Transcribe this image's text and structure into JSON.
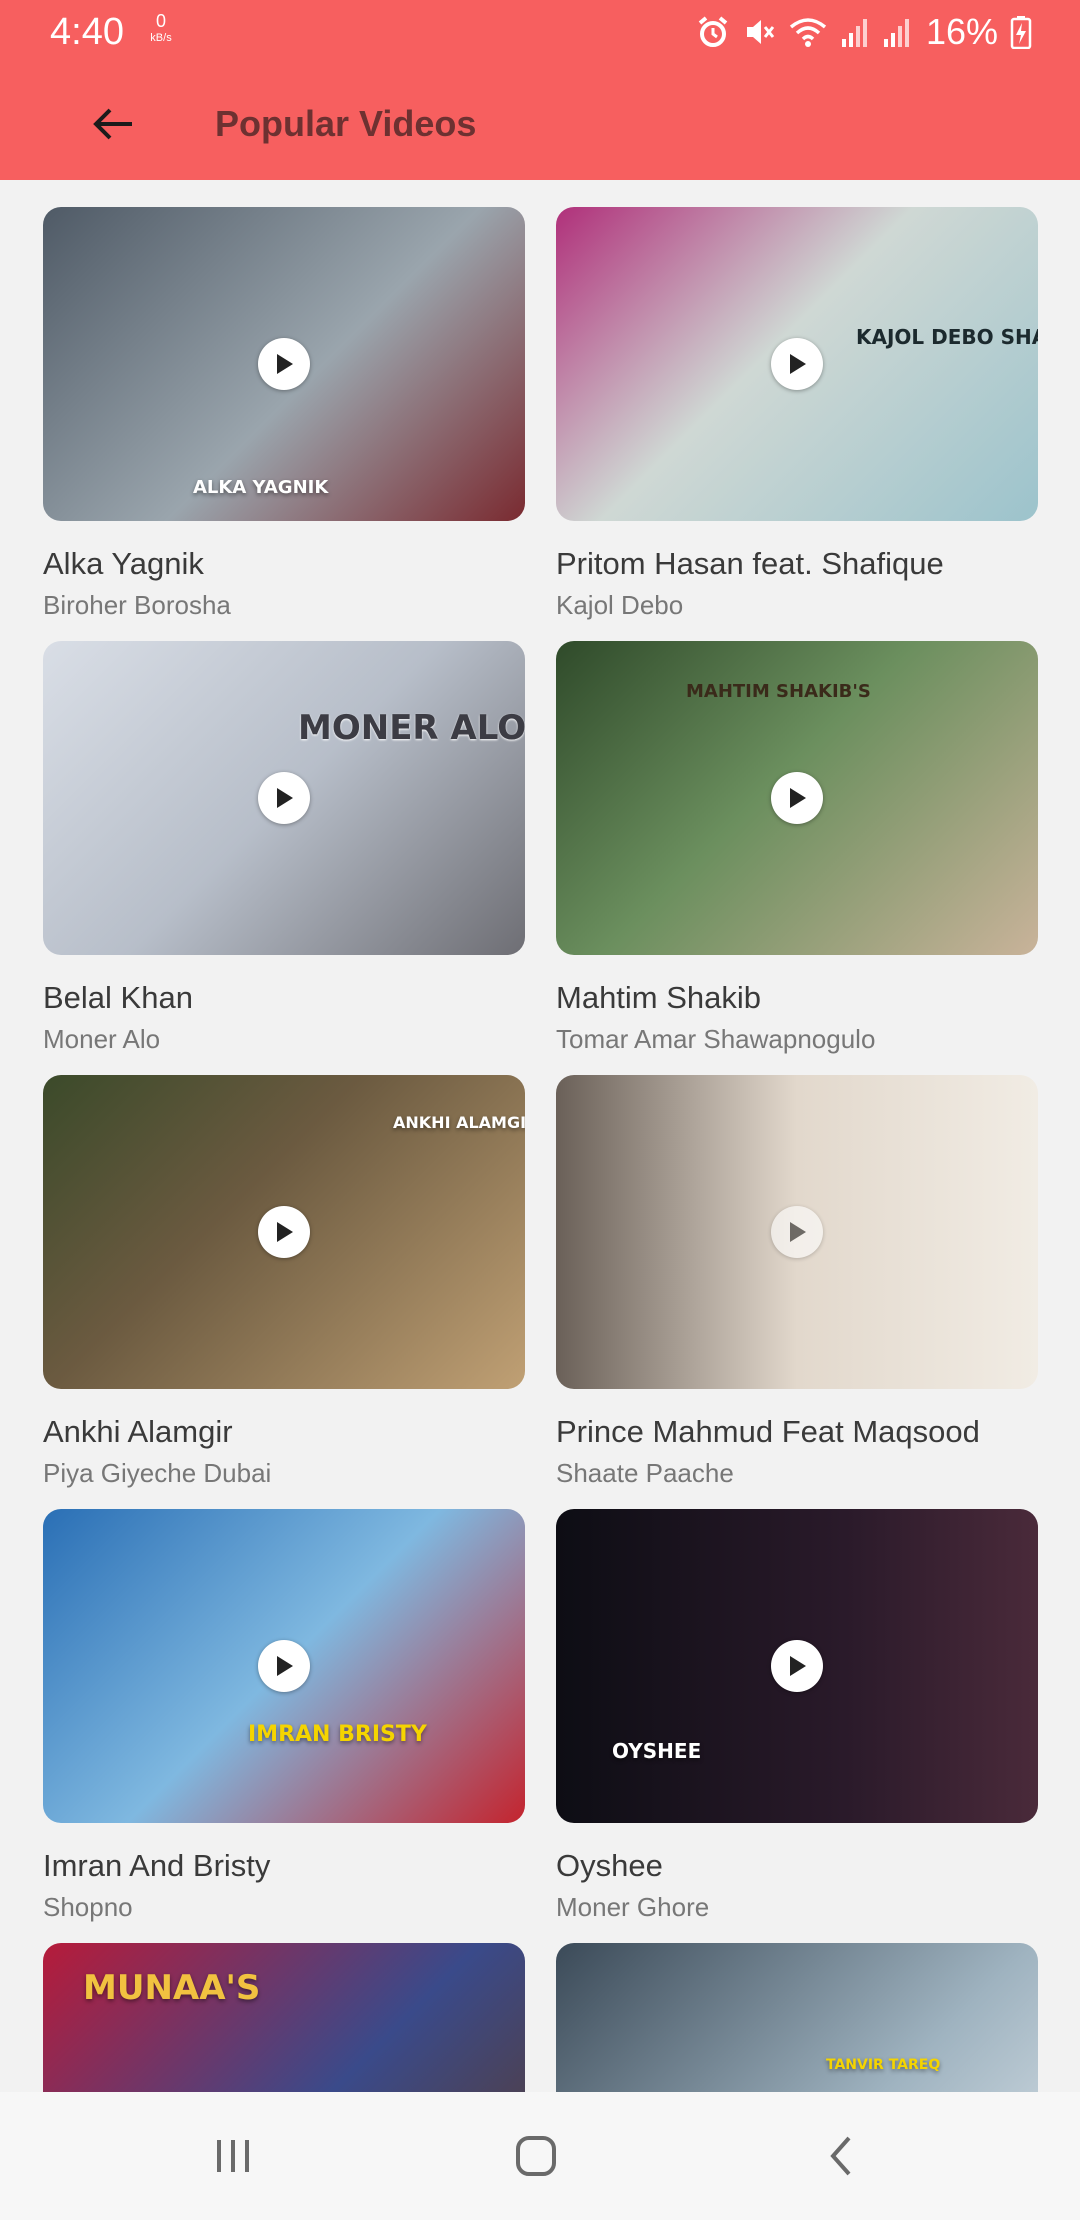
{
  "status_bar": {
    "time": "4:40",
    "net_speed": "0",
    "net_unit": "kB/s",
    "battery": "16%",
    "icons": [
      "alarm-icon",
      "mute-icon",
      "wifi-icon",
      "signal-icon",
      "signal-icon",
      "battery-charging-icon"
    ]
  },
  "app_bar": {
    "title": "Popular Videos",
    "back_icon": "arrow-left-icon",
    "background": "#f75f5f",
    "title_color": "#6d3131"
  },
  "videos": [
    {
      "artist": "Alka Yagnik",
      "title": "Biroher Borosha",
      "thumb_text": "ALKA YAGNIK",
      "colors": [
        "#4f5a66",
        "#9aa5ad",
        "#7a2a30"
      ]
    },
    {
      "artist": "Pritom Hasan feat. Shafique",
      "title": "Kajol Debo",
      "thumb_text": "KAJOL DEBO SHAFIQUE",
      "colors": [
        "#9cc3cc",
        "#cfd8d4",
        "#b0307a"
      ]
    },
    {
      "artist": "Belal Khan",
      "title": "Moner Alo",
      "thumb_text": "MONER ALO",
      "colors": [
        "#d9dee6",
        "#b7bec9",
        "#6e6e74"
      ]
    },
    {
      "artist": "Mahtim Shakib",
      "title": "Tomar Amar Shawapnogulo",
      "thumb_text": "MAHTIM SHAKIB'S",
      "colors": [
        "#6b8f5e",
        "#c9b39a",
        "#2f4a2a"
      ]
    },
    {
      "artist": "Ankhi Alamgir",
      "title": "Piya Giyeche Dubai",
      "thumb_text": "ANKHI ALAMGIR",
      "colors": [
        "#6b5a40",
        "#c0a074",
        "#3b4a2a"
      ]
    },
    {
      "artist": "Prince Mahmud Feat Maqsood",
      "title": "Shaate Paache",
      "thumb_text": "",
      "colors": [
        "#6a6058",
        "#e2d8cc",
        "#f1ece4"
      ]
    },
    {
      "artist": "Imran And Bristy",
      "title": "Shopno",
      "thumb_text": "IMRAN BRISTY",
      "colors": [
        "#2a6fb5",
        "#7fb8e0",
        "#c4242e"
      ]
    },
    {
      "artist": "Oyshee",
      "title": "Moner Ghore",
      "thumb_text": "OYSHEE",
      "colors": [
        "#0d0d14",
        "#2a1a2a",
        "#f2a01d"
      ]
    },
    {
      "artist": "",
      "title": "",
      "thumb_text": "MUNAA'S",
      "colors": [
        "#b61b3a",
        "#3a4a8a",
        "#f1c240"
      ]
    },
    {
      "artist": "",
      "title": "",
      "thumb_text": "TANVIR TAREQ",
      "colors": [
        "#3b4a58",
        "#9fb3c0",
        "#ffffff"
      ]
    }
  ],
  "nav_bar": {
    "recents_icon": "recents-icon",
    "home_icon": "home-icon",
    "back_icon": "chevron-left-icon"
  }
}
